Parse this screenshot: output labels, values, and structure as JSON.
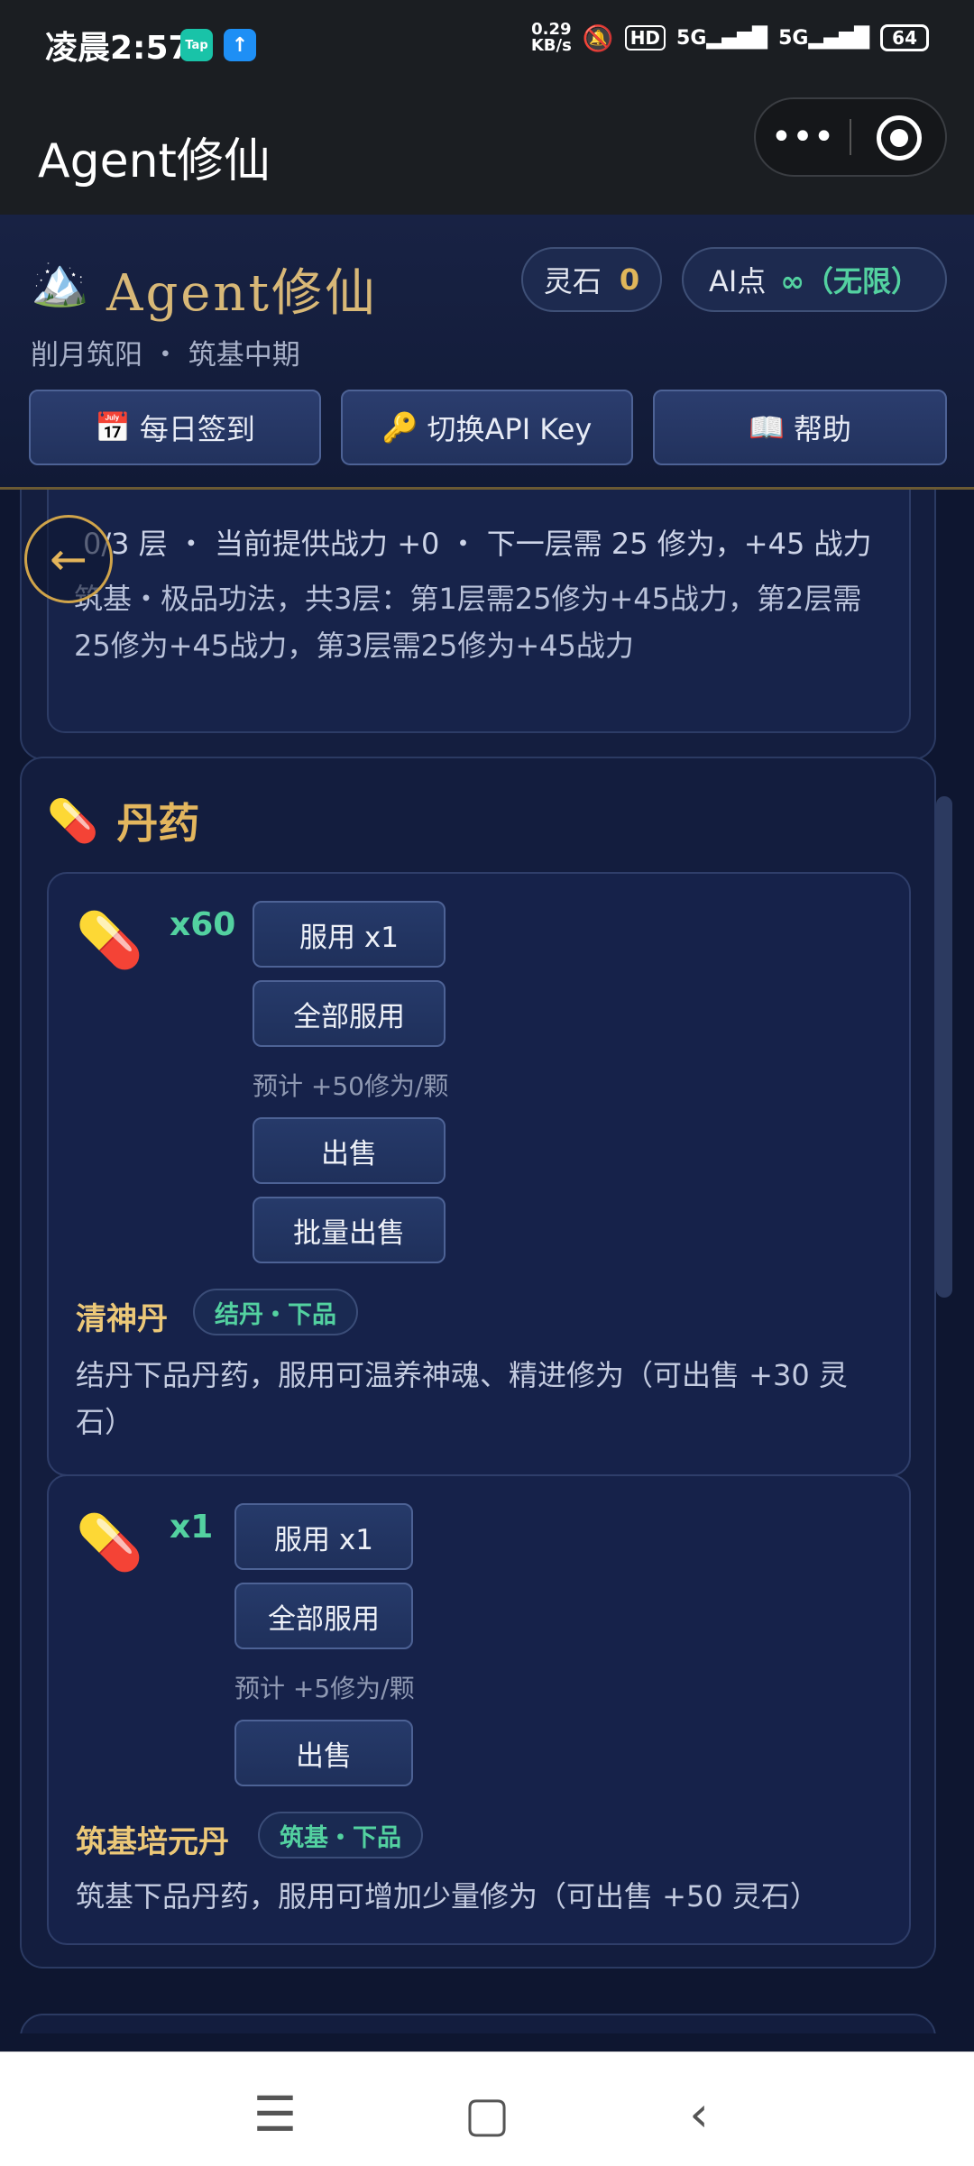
{
  "status_bar": {
    "time": "凌晨2:57",
    "app_icon_1": "Tap",
    "app_icon_2": "↑",
    "net_speed_value": "0.29",
    "net_speed_unit": "KB/s",
    "hd": "HD",
    "signal_1": "5G",
    "signal_2": "5G",
    "battery": "64"
  },
  "titlebar": {
    "title": "Agent修仙"
  },
  "header": {
    "title": "Agent修仙",
    "spirit_stone_label": "灵石",
    "spirit_stone_value": "0",
    "ai_label": "AI点",
    "ai_value": "∞（无限）",
    "subtitle": "削月筑阳 ・ 筑基中期",
    "buttons": {
      "checkin": "每日签到",
      "api_key": "切换API Key",
      "help": "帮助"
    }
  },
  "prev_section": {
    "line1": "0/3 层 ・ 当前提供战力 +0 ・ 下一层需 25 修为，+45 战力",
    "line2": "筑基・极品功法，共3层：第1层需25修为+45战力，第2层需25修为+45战力，第3层需25修为+45战力"
  },
  "pills_section": {
    "title": "丹药",
    "items": [
      {
        "qty": "x60",
        "use_one": "服用 x1",
        "use_all": "全部服用",
        "estimate": "预计 +50修为/颗",
        "sell": "出售",
        "bulk_sell": "批量出售",
        "name": "清神丹",
        "tag": "结丹・下品",
        "desc": "结丹下品丹药，服用可温养神魂、精进修为（可出售 +30 灵石）"
      },
      {
        "qty": "x1",
        "use_one": "服用 x1",
        "use_all": "全部服用",
        "estimate": "预计 +5修为/颗",
        "sell": "出售",
        "name": "筑基培元丹",
        "tag": "筑基・下品",
        "desc": "筑基下品丹药，服用可增加少量修为（可出售 +50 灵石）"
      }
    ]
  },
  "icons": {
    "logo": "mountain-icon",
    "pill": "pill-icon",
    "calendar": "calendar-icon",
    "key": "key-icon",
    "book": "book-icon",
    "back": "arrow-left-icon"
  },
  "colors": {
    "gold": "#e0b65a",
    "green": "#53d1a0",
    "background": "#0e1630"
  }
}
